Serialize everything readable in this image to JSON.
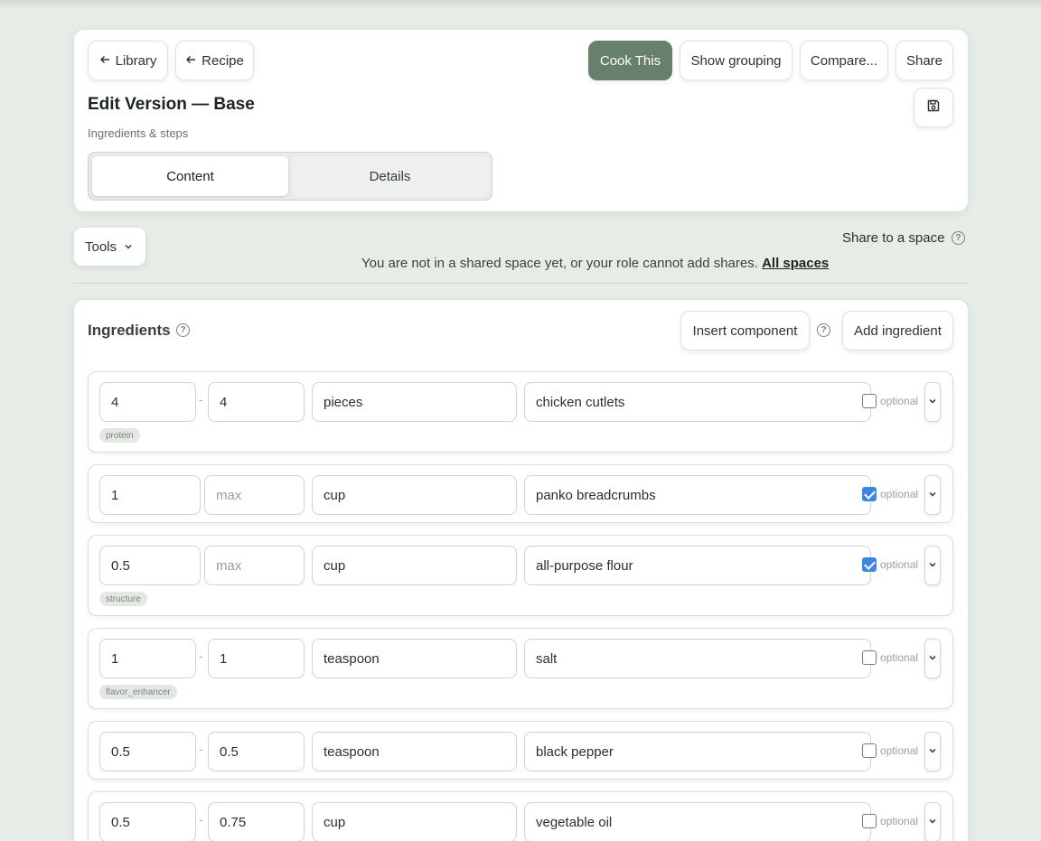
{
  "header": {
    "back_library": "Library",
    "back_recipe": "Recipe",
    "cook_this": "Cook This",
    "show_grouping": "Show grouping",
    "compare": "Compare...",
    "share": "Share",
    "title": "Edit Version — Base",
    "subtitle": "Ingredients & steps",
    "tabs": [
      {
        "label": "Content",
        "active": true
      },
      {
        "label": "Details",
        "active": false
      }
    ]
  },
  "tools": {
    "label": "Tools"
  },
  "share_space": {
    "heading": "Share to a space",
    "message": "You are not in a shared space yet, or your role cannot add shares.",
    "link": "All spaces"
  },
  "ingredients": {
    "heading": "Ingredients",
    "insert_component": "Insert component",
    "add_ingredient": "Add ingredient",
    "max_placeholder": "max",
    "optional_label": "optional",
    "rows": [
      {
        "min": "4",
        "max": "4",
        "unit": "pieces",
        "name": "chicken cutlets",
        "optional": false,
        "tag": "protein"
      },
      {
        "min": "1",
        "max": "",
        "unit": "cup",
        "name": "panko breadcrumbs",
        "optional": true,
        "tag": ""
      },
      {
        "min": "0.5",
        "max": "",
        "unit": "cup",
        "name": "all-purpose flour",
        "optional": true,
        "tag": "structure"
      },
      {
        "min": "1",
        "max": "1",
        "unit": "teaspoon",
        "name": "salt",
        "optional": false,
        "tag": "flavor_enhancer"
      },
      {
        "min": "0.5",
        "max": "0.5",
        "unit": "teaspoon",
        "name": "black pepper",
        "optional": false,
        "tag": ""
      },
      {
        "min": "0.5",
        "max": "0.75",
        "unit": "cup",
        "name": "vegetable oil",
        "optional": false,
        "tag": ""
      }
    ]
  },
  "colors": {
    "primary": "#687f6e",
    "background": "#e6ece6",
    "checkbox": "#3d86e4"
  }
}
